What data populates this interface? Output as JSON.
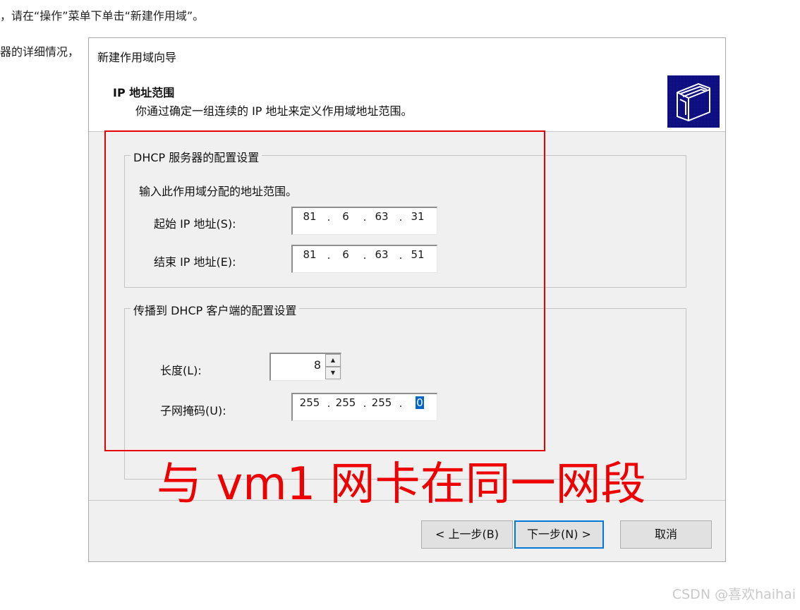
{
  "background_text": {
    "line1": "，请在“操作”菜单下单击“新建作用域”。",
    "line2": "器的详细情况，"
  },
  "dialog": {
    "title": "新建作用域向导",
    "section_title": "IP 地址范围",
    "section_subtitle": "你通过确定一组连续的 IP 地址来定义作用域地址范围。",
    "icon": "folder-wizard-icon"
  },
  "server_group": {
    "legend": "DHCP 服务器的配置设置",
    "prompt": "输入此作用域分配的地址范围。",
    "start_label": "起始 IP 地址(S):",
    "start_ip": [
      "81",
      "6",
      "63",
      "31"
    ],
    "end_label": "结束 IP 地址(E):",
    "end_ip": [
      "81",
      "6",
      "63",
      "51"
    ]
  },
  "client_group": {
    "legend": "传播到 DHCP 客户端的配置设置",
    "length_label": "长度(L):",
    "length_value": "8",
    "mask_label": "子网掩码(U):",
    "mask": [
      "255",
      "255",
      "255",
      "0"
    ]
  },
  "buttons": {
    "back": "< 上一步(B)",
    "next": "下一步(N) >",
    "cancel": "取消"
  },
  "annotation": {
    "text": "与 vm1 网卡在同一网段",
    "color": "#ee0000"
  },
  "watermark": "CSDN @喜欢haihai"
}
